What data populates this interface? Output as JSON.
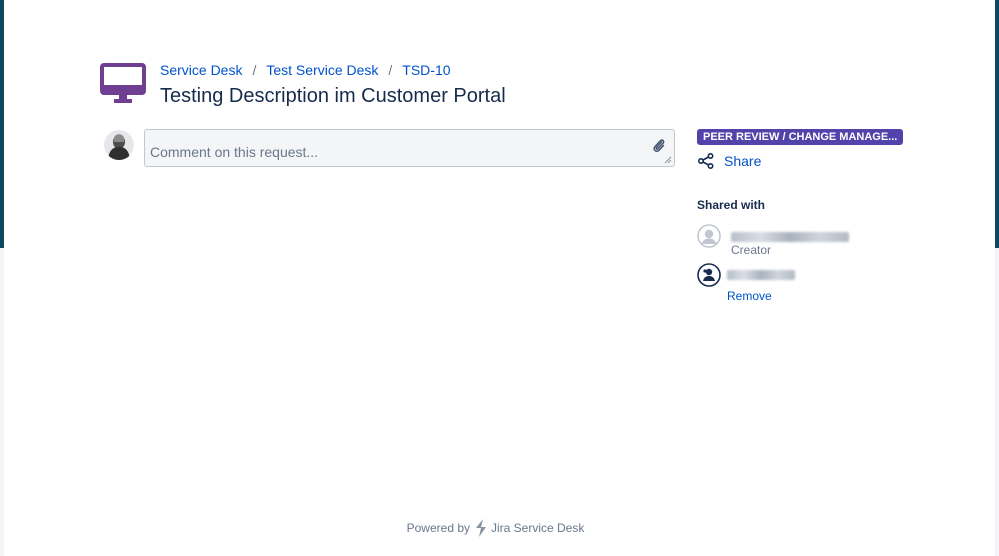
{
  "breadcrumb": [
    {
      "label": "Service Desk"
    },
    {
      "label": "Test Service Desk"
    },
    {
      "label": "TSD-10"
    }
  ],
  "breadcrumb_separator": "/",
  "request": {
    "title": "Testing Description im Customer Portal",
    "icon": "computer-monitor-icon"
  },
  "comment": {
    "placeholder": "Comment on this request...",
    "value": ""
  },
  "sidebar": {
    "status": "PEER REVIEW / CHANGE MANAGE...",
    "share_label": "Share",
    "shared_with_heading": "Shared with",
    "participants": [
      {
        "role": "Creator"
      },
      {
        "action": "Remove"
      }
    ]
  },
  "footer": {
    "powered_by": "Powered by",
    "product": "Jira Service Desk"
  },
  "colors": {
    "link": "#0052cc",
    "status_lozenge": "#5243aa",
    "top_band": "#0b4a5e",
    "icon_purple": "#6f3f91"
  }
}
